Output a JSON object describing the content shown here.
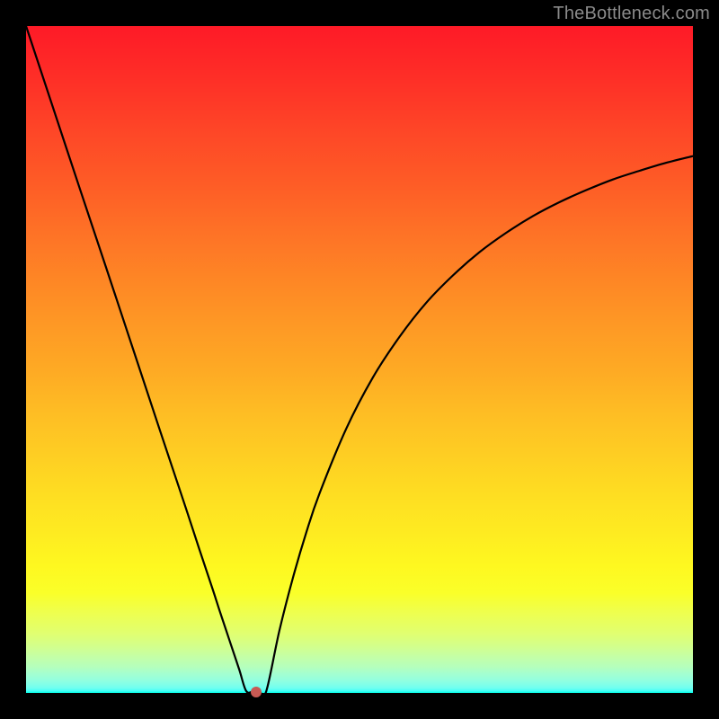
{
  "watermark": "TheBottleneck.com",
  "chart_data": {
    "type": "line",
    "title": "",
    "xlabel": "",
    "ylabel": "",
    "ylim": [
      0,
      100
    ],
    "xlim": [
      0,
      100
    ],
    "x": [
      0,
      4,
      8,
      12,
      16,
      20,
      22,
      24,
      26,
      28,
      29,
      30,
      31,
      32,
      33,
      34,
      35,
      36,
      38,
      40,
      42,
      44,
      48,
      52,
      56,
      60,
      64,
      68,
      72,
      76,
      80,
      84,
      88,
      92,
      96,
      100
    ],
    "values": [
      100,
      87.9,
      75.8,
      63.8,
      51.7,
      39.6,
      33.6,
      27.6,
      21.5,
      15.5,
      12.4,
      9.4,
      6.4,
      3.4,
      0.3,
      0.2,
      0.2,
      0.2,
      9.4,
      17.2,
      24.0,
      29.9,
      39.6,
      47.3,
      53.4,
      58.5,
      62.6,
      66.1,
      69.0,
      71.5,
      73.6,
      75.4,
      77.0,
      78.3,
      79.5,
      80.5
    ],
    "min_point": {
      "x": 34.5,
      "y": 0.2
    },
    "annotations": [],
    "grid": false,
    "legend": false,
    "background_gradient": {
      "direction": "vertical",
      "stops": [
        {
          "pct": 0,
          "color": "#fe1a27"
        },
        {
          "pct": 50,
          "color": "#fea524"
        },
        {
          "pct": 82,
          "color": "#fefc20"
        },
        {
          "pct": 100,
          "color": "#00ffe6"
        }
      ]
    }
  }
}
